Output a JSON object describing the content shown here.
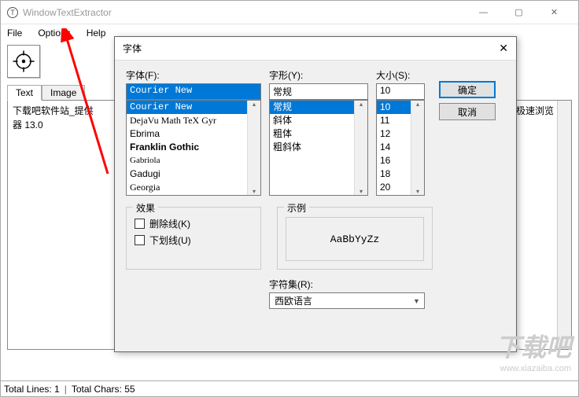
{
  "main": {
    "title": "WindowTextExtractor",
    "menu": {
      "file": "File",
      "options": "Options",
      "help": "Help"
    },
    "tabs": {
      "text": "Text",
      "image": "Image"
    },
    "content": "下载吧软件站_提供\n器 13.0",
    "content_right": "极速浏览",
    "status": {
      "lines_label": "Total Lines:",
      "lines_val": "1",
      "chars_label": "Total Chars:",
      "chars_val": "55"
    }
  },
  "dialog": {
    "title": "字体",
    "font_label": "字体(F):",
    "style_label": "字形(Y):",
    "size_label": "大小(S):",
    "font_value": "Courier New",
    "style_value": "常规",
    "size_value": "10",
    "fonts": [
      "Courier New",
      "DejaVu Math TeX Gyr",
      "Ebrima",
      "Franklin Gothic",
      "Gabriola",
      "Gadugi",
      "Georgia"
    ],
    "styles": [
      "常规",
      "斜体",
      "粗体",
      "粗斜体"
    ],
    "sizes": [
      "10",
      "11",
      "12",
      "14",
      "16",
      "18",
      "20"
    ],
    "ok": "确定",
    "cancel": "取消",
    "effects_label": "效果",
    "strikeout": "删除线(K)",
    "underline": "下划线(U)",
    "sample_label": "示例",
    "sample_text": "AaBbYyZz",
    "charset_label": "字符集(R):",
    "charset_value": "西欧语言"
  },
  "watermark": {
    "logo": "下载吧",
    "url": "www.xiazaiba.com"
  }
}
